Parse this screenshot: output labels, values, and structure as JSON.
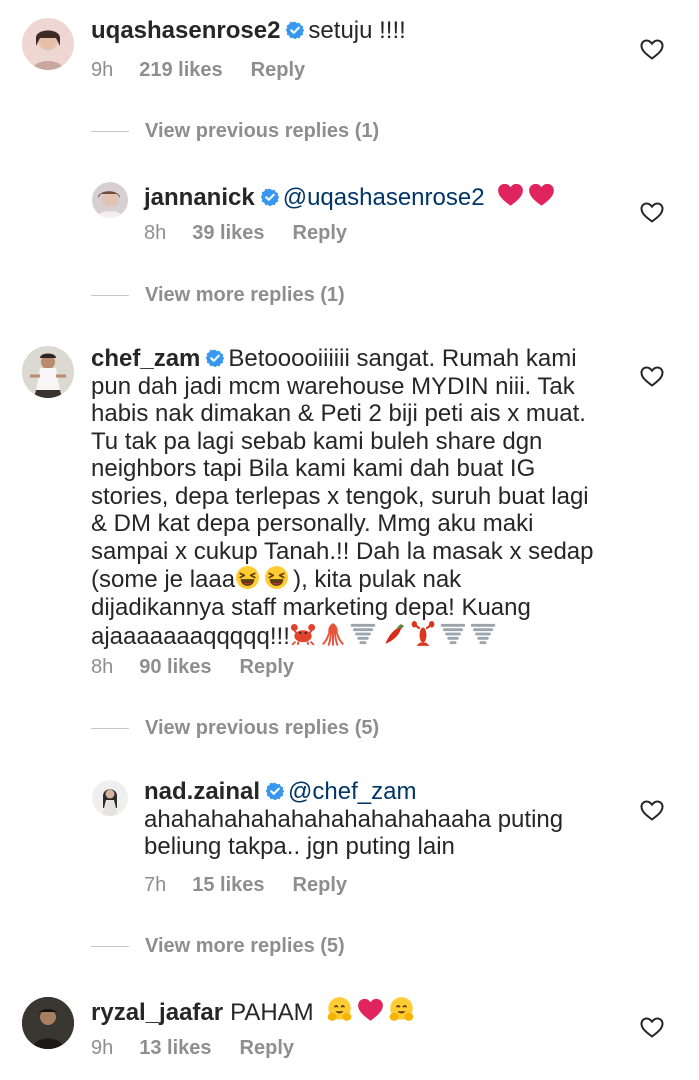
{
  "comments": [
    {
      "username": "uqashasenrose2",
      "text": "setuju !!!!",
      "time": "9h",
      "likes": "219 likes",
      "reply": "Reply"
    },
    {
      "username": "jannanick",
      "mention": "@uqashasenrose2",
      "time": "8h",
      "likes": "39 likes",
      "reply": "Reply"
    },
    {
      "username": "chef_zam",
      "text_lines": [
        "Betooooiiiiii sangat.  Rumah kami",
        "pun dah jadi mcm warehouse MYDIN niii.  Tak",
        "habis nak dimakan & Peti 2 biji peti ais x muat.",
        "Tu tak pa lagi sebab kami buleh share dgn",
        "neighbors tapi Bila kami kami dah buat IG",
        "stories, depa terlepas x tengok, suruh buat lagi",
        "& DM kat depa personally.  Mmg aku maki",
        "sampai x cukup Tanah.!! Dah la masak x sedap",
        "(some je laaa",
        "), kita pulak nak",
        "dijadikannya staff marketing depa!  Kuang",
        "ajaaaaaaaqqqqq!!!"
      ],
      "time": "8h",
      "likes": "90 likes",
      "reply": "Reply"
    },
    {
      "username": "nad.zainal",
      "mention": "@chef_zam",
      "text_lines": [
        "ahahahahahahahahahahahaaha puting",
        "beliung takpa.. jgn puting lain"
      ],
      "time": "7h",
      "likes": "15 likes",
      "reply": "Reply"
    },
    {
      "username": "ryzal_jaafar",
      "text": "PAHAM",
      "time": "9h",
      "likes": "13 likes",
      "reply": "Reply"
    }
  ],
  "toggles": {
    "prev1": "View previous replies (1)",
    "more1": "View more replies (1)",
    "prev5": "View previous replies (5)",
    "more5": "View more replies (5)"
  },
  "icons": {
    "verified": "verified-badge-icon",
    "like": "heart-outline-icon"
  },
  "colors": {
    "verified_blue": "#3897f0",
    "secondary_text": "#8e8e8e",
    "primary_text": "#262626",
    "mention": "#003569",
    "emoji_heart": "#e0245e"
  }
}
